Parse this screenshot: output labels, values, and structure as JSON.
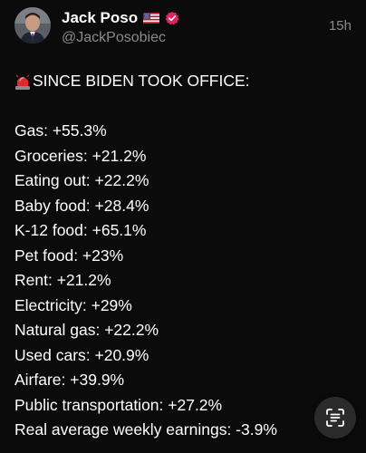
{
  "post": {
    "display_name": "Jack Poso",
    "handle": "@JackPosobiec",
    "timestamp": "15h",
    "headline": "SINCE BIDEN TOOK OFFICE:",
    "headline_icon": "police-siren-icon",
    "name_icons": [
      "us-flag-icon",
      "verified-badge-icon"
    ],
    "stats": [
      "Gas: +55.3%",
      "Groceries: +21.2%",
      "Eating out: +22.2%",
      "Baby food: +28.4%",
      "K-12 food: +65.1%",
      "Pet food: +23%",
      "Rent: +21.2%",
      "Electricity: +29%",
      "Natural gas: +22.2%",
      "Used cars: +20.9%",
      "Airfare: +39.9%",
      "Public transportation: +27.2%",
      "Real average weekly earnings: -3.9%"
    ]
  },
  "floating_button": {
    "icon": "scan-text-icon"
  },
  "colors": {
    "background": "#0b0b0b",
    "text": "#ffffff",
    "secondary_text": "#8b8b8b",
    "verified_badge": "#e0245e",
    "button_bg": "#2b2b2b"
  }
}
